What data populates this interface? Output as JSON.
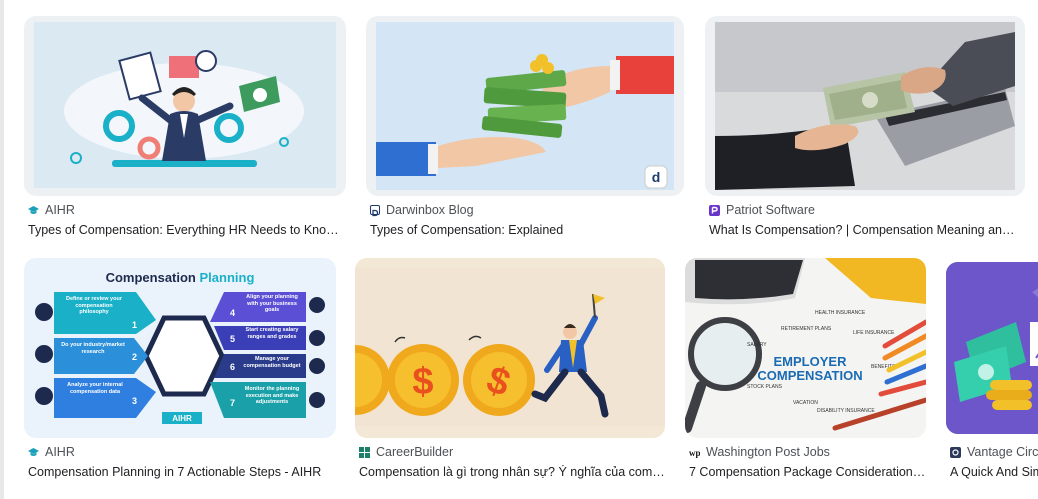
{
  "results": [
    {
      "source": "AIHR",
      "title": "Types of Compensation: Everything HR Needs to Know …",
      "favicon_color": "#1aa0b8",
      "favicon": "graduation-cap-icon"
    },
    {
      "source": "Darwinbox Blog",
      "title": "Types of Compensation: Explained",
      "favicon_color": "#1f3a6e",
      "favicon": "letter-d-icon"
    },
    {
      "source": "Patriot Software",
      "title": "What Is Compensation? | Compensation Meaning and …",
      "favicon_color": "#6a35c9",
      "favicon": "letter-p-icon"
    },
    {
      "source": "AIHR",
      "title": "Compensation Planning in 7 Actionable Steps - AIHR",
      "favicon_color": "#1aa0b8",
      "favicon": "graduation-cap-icon"
    },
    {
      "source": "CareerBuilder",
      "title": "Compensation là gì trong nhân sự? Ý nghĩa của comp…",
      "favicon_color": "#1b7f6a",
      "favicon": "squares-icon"
    },
    {
      "source": "Washington Post Jobs",
      "title": "7 Compensation Package Consideration…",
      "favicon_color": "#111111",
      "favicon": "wp-logo-icon"
    },
    {
      "source": "Vantage Circle",
      "title": "A Quick And Sim",
      "favicon_color": "#2c3a5c",
      "favicon": "circle-icon"
    }
  ],
  "thumbs": {
    "planning": {
      "heading_a": "Compensation ",
      "heading_b": "Planning",
      "left_steps": [
        {
          "num": "1",
          "text": "Define or review your compensation philosophy"
        },
        {
          "num": "2",
          "text": "Do your industry/market research"
        },
        {
          "num": "3",
          "text": "Analyze your internal compensation data"
        }
      ],
      "right_steps": [
        {
          "num": "4",
          "text": "Align your planning with your business goals"
        },
        {
          "num": "5",
          "text": "Start creating salary ranges and grades"
        },
        {
          "num": "6",
          "text": "Manage your compensation budget"
        },
        {
          "num": "7",
          "text": "Monitor the planning execution and make adjustments"
        }
      ],
      "brand": "AIHR"
    },
    "darwinbox_badge": "d",
    "employer": {
      "line1": "EMPLOYER",
      "line2": "COMPENSATION",
      "words": [
        "HEALTH INSURANCE",
        "RETIREMENT PLANS",
        "LIFE INSURANCE",
        "SALARY",
        "STOCK PLANS",
        "VACATION",
        "DISABILITY INSURANCE",
        "BENEFITS"
      ]
    }
  }
}
